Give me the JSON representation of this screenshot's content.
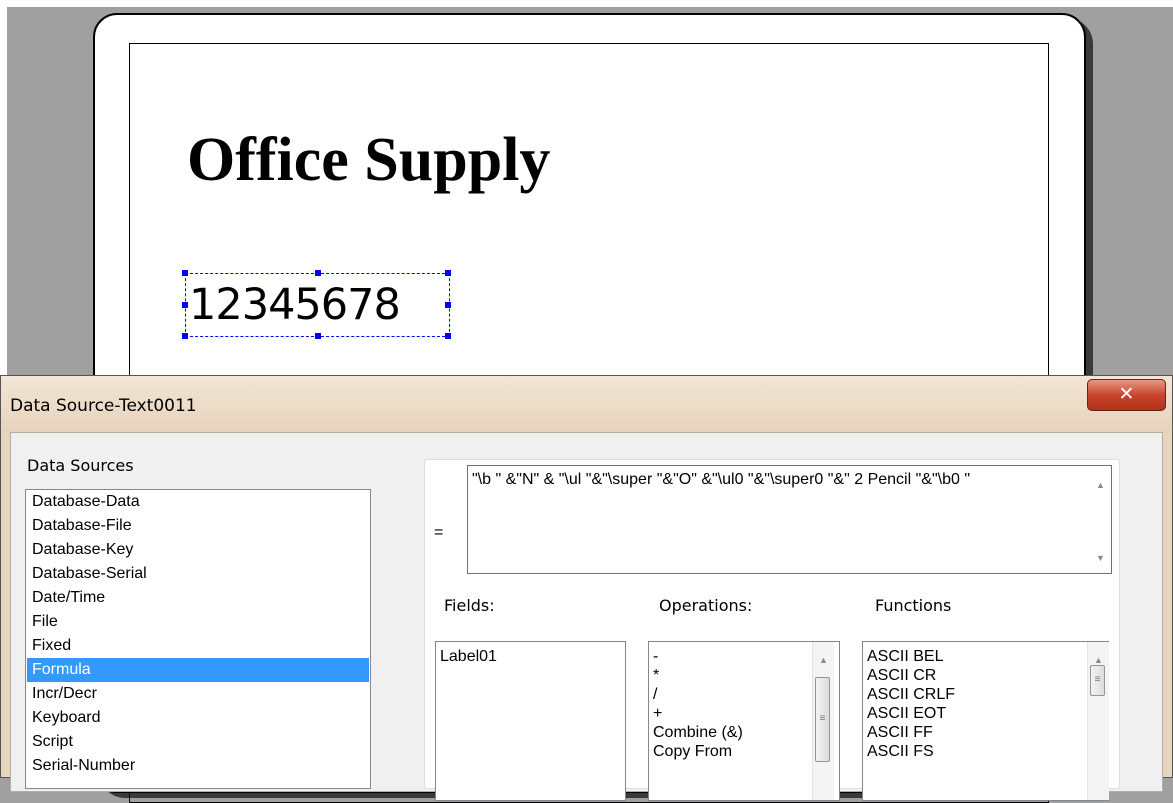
{
  "label": {
    "title": "Office Supply",
    "serial_text": "12345678"
  },
  "dialog": {
    "title": "Data Source-Text0011",
    "close_icon": "close-icon",
    "data_sources_label": "Data Sources",
    "data_sources": [
      "Database-Data",
      "Database-File",
      "Database-Key",
      "Database-Serial",
      "Date/Time",
      "File",
      "Fixed",
      "Formula",
      "Incr/Decr",
      "Keyboard",
      "Script",
      "Serial-Number"
    ],
    "selected_source": "Formula",
    "equals": "=",
    "formula": "\"\\b \" &\"N\" & \"\\ul \"&\"\\super \"&\"O\" &\"\\ul0 \"&\"\\super0 \"&\" 2 Pencil \"&\"\\b0 \"",
    "fields_label": "Fields:",
    "fields": [
      "Label01"
    ],
    "operations_label": "Operations:",
    "operations": [
      "-",
      "*",
      "/",
      "+",
      "Combine (&)",
      "Copy From"
    ],
    "functions_label": "Functions",
    "functions": [
      "ASCII BEL",
      "ASCII CR",
      "ASCII CRLF",
      "ASCII EOT",
      "ASCII FF",
      "ASCII FS"
    ]
  },
  "colors": {
    "selection_blue": "#3399ff",
    "handle_blue": "#0000ff",
    "close_red": "#c8462e",
    "dialog_frame": "#e7d6bf"
  }
}
